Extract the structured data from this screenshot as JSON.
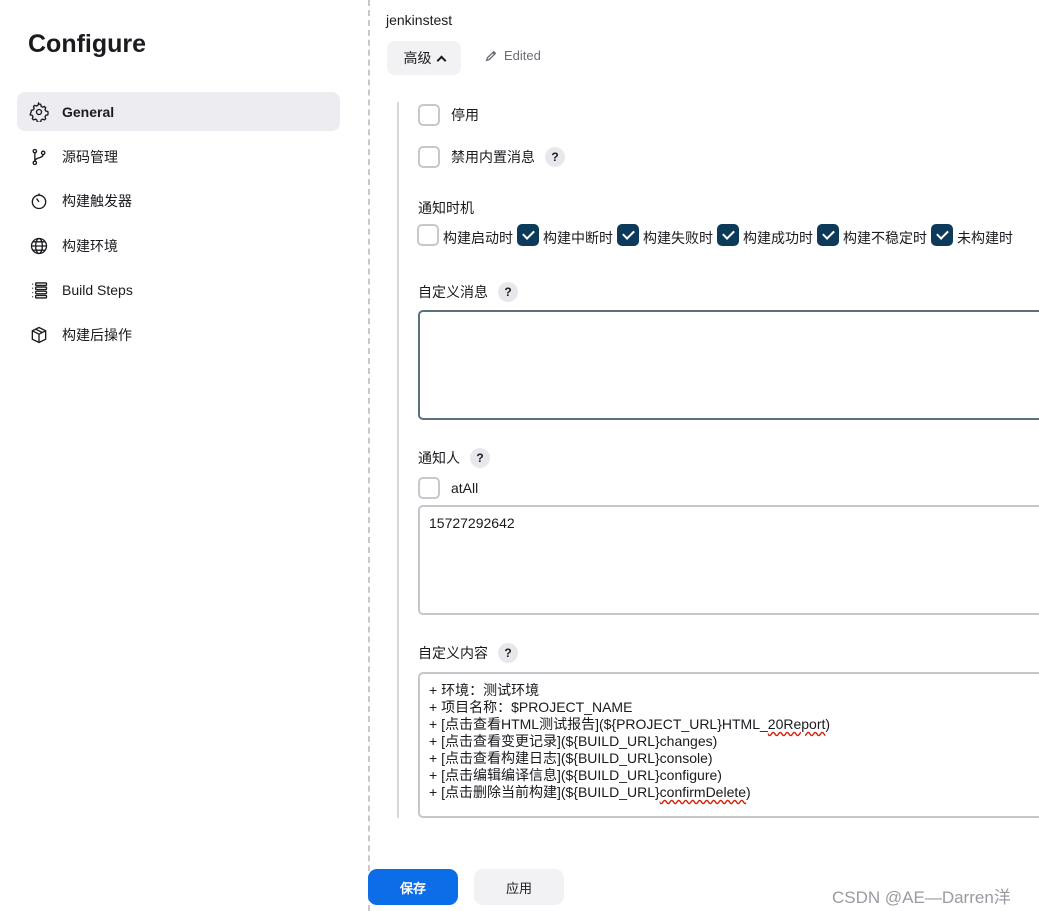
{
  "sidebar": {
    "title": "Configure",
    "items": [
      {
        "label": "General",
        "icon": "gear-icon",
        "active": true
      },
      {
        "label": "源码管理",
        "icon": "branch-icon"
      },
      {
        "label": "构建触发器",
        "icon": "timer-icon"
      },
      {
        "label": "构建环境",
        "icon": "globe-icon"
      },
      {
        "label": "Build Steps",
        "icon": "list-icon"
      },
      {
        "label": "构建后操作",
        "icon": "package-icon"
      }
    ]
  },
  "main": {
    "job_name": "jenkinstest",
    "advanced_label": "高级",
    "edited_label": "Edited",
    "disable_label": "停用",
    "disable_builtin_msg_label": "禁用内置消息",
    "help_glyph": "?",
    "notify_timing_label": "通知时机",
    "timing_options": [
      {
        "label": "构建启动时",
        "checked": false
      },
      {
        "label": "构建中断时",
        "checked": true
      },
      {
        "label": "构建失败时",
        "checked": true
      },
      {
        "label": "构建成功时",
        "checked": true
      },
      {
        "label": "构建不稳定时",
        "checked": true
      },
      {
        "label": "未构建时",
        "checked": true
      }
    ],
    "custom_message_label": "自定义消息",
    "custom_message_value": "",
    "notify_people_label": "通知人",
    "at_all_label": "atAll",
    "notify_people_value": "15727292642",
    "custom_content_label": "自定义内容",
    "custom_content_lines": [
      "+ 环境：测试环境",
      "+ 项目名称：$PROJECT_NAME",
      "+ [点击查看HTML测试报告](${PROJECT_URL}HTML_",
      "20Report",
      ")",
      "+ [点击查看变更记录](${BUILD_URL}changes)",
      "+ [点击查看构建日志](${BUILD_URL}console)",
      "+ [点击编辑编译信息](${BUILD_URL}configure)",
      "+ [点击删除当前构建](${BUILD_URL}",
      "confirmDelete",
      ")"
    ]
  },
  "footer": {
    "save_label": "保存",
    "apply_label": "应用",
    "watermark": "CSDN @AE—Darren洋"
  }
}
